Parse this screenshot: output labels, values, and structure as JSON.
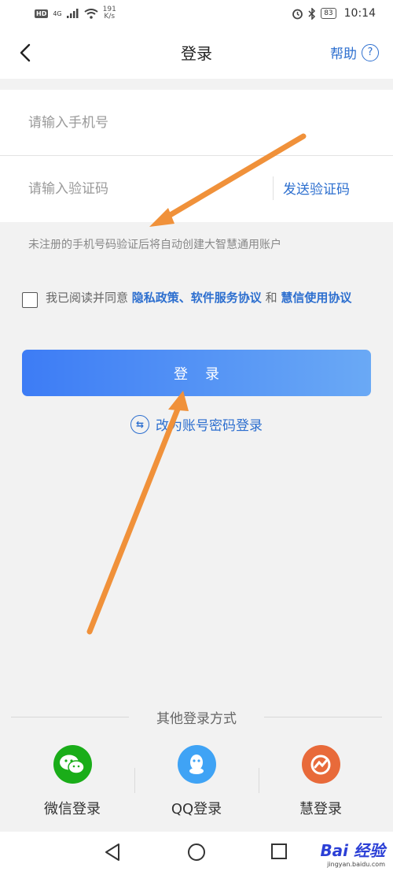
{
  "status_bar": {
    "hd": "HD",
    "network": "4G",
    "speed_value": "191",
    "speed_unit": "K/s",
    "battery": "83",
    "time": "10:14"
  },
  "header": {
    "title": "登录",
    "help_label": "帮助",
    "help_icon": "question-circle-icon",
    "back_icon": "chevron-left-icon"
  },
  "form": {
    "phone_placeholder": "请输入手机号",
    "phone_value": "",
    "code_placeholder": "请输入验证码",
    "code_value": "",
    "send_code_label": "发送验证码"
  },
  "hint": "未注册的手机号码验证后将自动创建大智慧通用账户",
  "agreement": {
    "checked": false,
    "prefix": "我已阅读并同意 ",
    "link1": "隐私政策、软件服务协议",
    "connector": " 和 ",
    "link2": "慧信使用协议"
  },
  "login_button": "登录",
  "switch_login": "改为账号密码登录",
  "other_methods": {
    "title": "其他登录方式",
    "items": [
      {
        "label": "微信登录",
        "icon": "wechat-icon",
        "color": "#1aad19"
      },
      {
        "label": "QQ登录",
        "icon": "qq-icon",
        "color": "#3fa3f5"
      },
      {
        "label": "慧登录",
        "icon": "hui-icon",
        "color": "#e86a3a"
      }
    ]
  },
  "watermark": {
    "main": "Bai 经验",
    "sub": "jingyan.baidu.com"
  },
  "colors": {
    "accent": "#2d6fcf",
    "button_start": "#3d7cf5",
    "button_end": "#6aa9f5",
    "annotation_arrow": "#f0913a"
  }
}
